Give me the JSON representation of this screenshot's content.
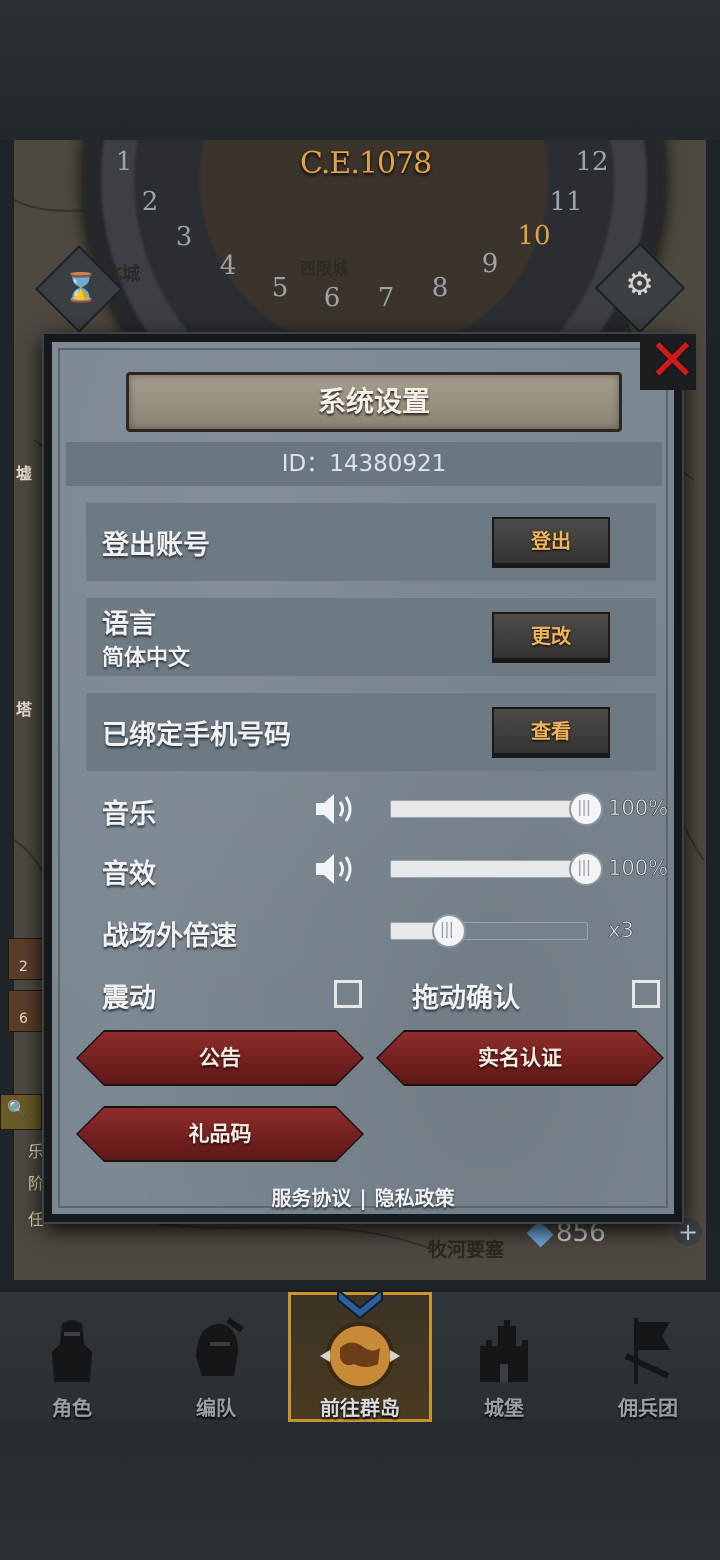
{
  "header": {
    "era": "C.E.1078",
    "dial_numbers": [
      "1",
      "2",
      "3",
      "4",
      "5",
      "6",
      "7",
      "8",
      "9",
      "10",
      "11",
      "12"
    ],
    "highlighted_number": "10",
    "map_labels": {
      "north_city": "北城",
      "west_city": "西限城",
      "tower": "塔",
      "ruins": "墟"
    }
  },
  "map": {
    "resource_value": "856",
    "place_name": "牧河要塞",
    "side_badges": [
      "2",
      "6"
    ],
    "side_texts": [
      "乐",
      "阶",
      "任"
    ]
  },
  "dialog": {
    "title": "系统设置",
    "id_text": "ID：14380921",
    "logout": {
      "label": "登出账号",
      "button": "登出"
    },
    "language": {
      "label": "语言",
      "value": "简体中文",
      "button": "更改"
    },
    "phone": {
      "label": "已绑定手机号码",
      "button": "查看"
    },
    "music": {
      "label": "音乐",
      "value": "100%",
      "level": 1.0
    },
    "sound": {
      "label": "音效",
      "value": "100%",
      "level": 1.0
    },
    "speed": {
      "label": "战场外倍速",
      "value": "x3",
      "level": 0.3
    },
    "vibration": {
      "label": "震动",
      "checked": false
    },
    "drag_confirm": {
      "label": "拖动确认",
      "checked": false
    },
    "buttons": {
      "announcement": "公告",
      "real_name": "实名认证",
      "gift_code": "礼品码"
    },
    "footer": {
      "service": "服务协议",
      "separator": "|",
      "privacy": "隐私政策"
    }
  },
  "nav": {
    "items": [
      {
        "label": "角色",
        "icon": "knight-icon"
      },
      {
        "label": "编队",
        "icon": "helmet-icon"
      },
      {
        "label": "前往群岛",
        "icon": "globe-icon",
        "active": true
      },
      {
        "label": "城堡",
        "icon": "castle-icon"
      },
      {
        "label": "佣兵团",
        "icon": "banner-icon"
      }
    ]
  },
  "colors": {
    "accent_gold": "#f2b45a",
    "close_red": "#c91c1c",
    "button_red": "#8d2c2a",
    "active_nav": "#c99530"
  }
}
